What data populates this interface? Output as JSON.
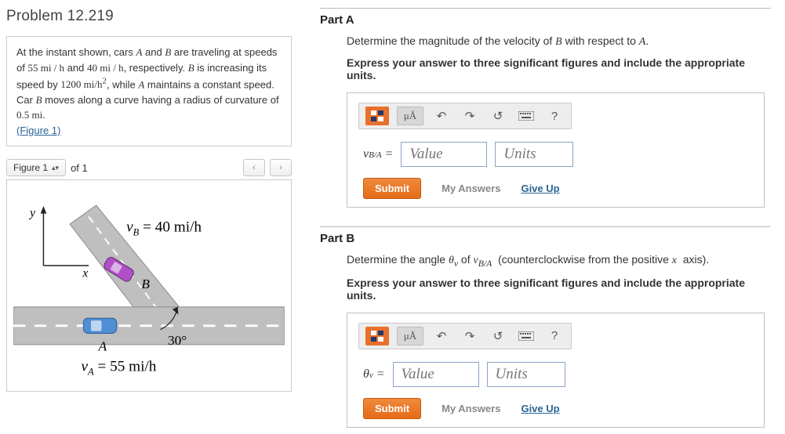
{
  "problem": {
    "title": "Problem 12.219",
    "statement_html": "At the instant shown, cars A and B are traveling at speeds of 55 mi / h and 40 mi / h, respectively. B is increasing its speed by 1200 mi/h², while A maintains a constant speed. Car B moves along a curve having a radius of curvature of 0.5 mi.",
    "figure_link": "(Figure 1)"
  },
  "figure": {
    "selector_label": "Figure 1",
    "of_text": "of 1",
    "vB_label": "vB = 40 mi/h",
    "vA_label": "vA = 55 mi/h",
    "angle": "30°",
    "y_label": "y",
    "x_label": "x",
    "car_a": "A",
    "car_b": "B"
  },
  "toolbar": {
    "units_btn": "μÅ",
    "help": "?"
  },
  "partA": {
    "title": "Part A",
    "question": "Determine the magnitude of the velocity of B with respect to A.",
    "instruction": "Express your answer to three significant figures and include the appropriate units.",
    "lhs": "vB/A =",
    "value_ph": "Value",
    "units_ph": "Units",
    "submit": "Submit",
    "my_answers": "My Answers",
    "giveup": "Give Up"
  },
  "partB": {
    "title": "Part B",
    "question": "Determine the angle θv of vB/A (counterclockwise from the positive x axis).",
    "instruction": "Express your answer to three significant figures and include the appropriate units.",
    "lhs": "θv =",
    "value_ph": "Value",
    "units_ph": "Units",
    "submit": "Submit",
    "my_answers": "My Answers",
    "giveup": "Give Up"
  }
}
